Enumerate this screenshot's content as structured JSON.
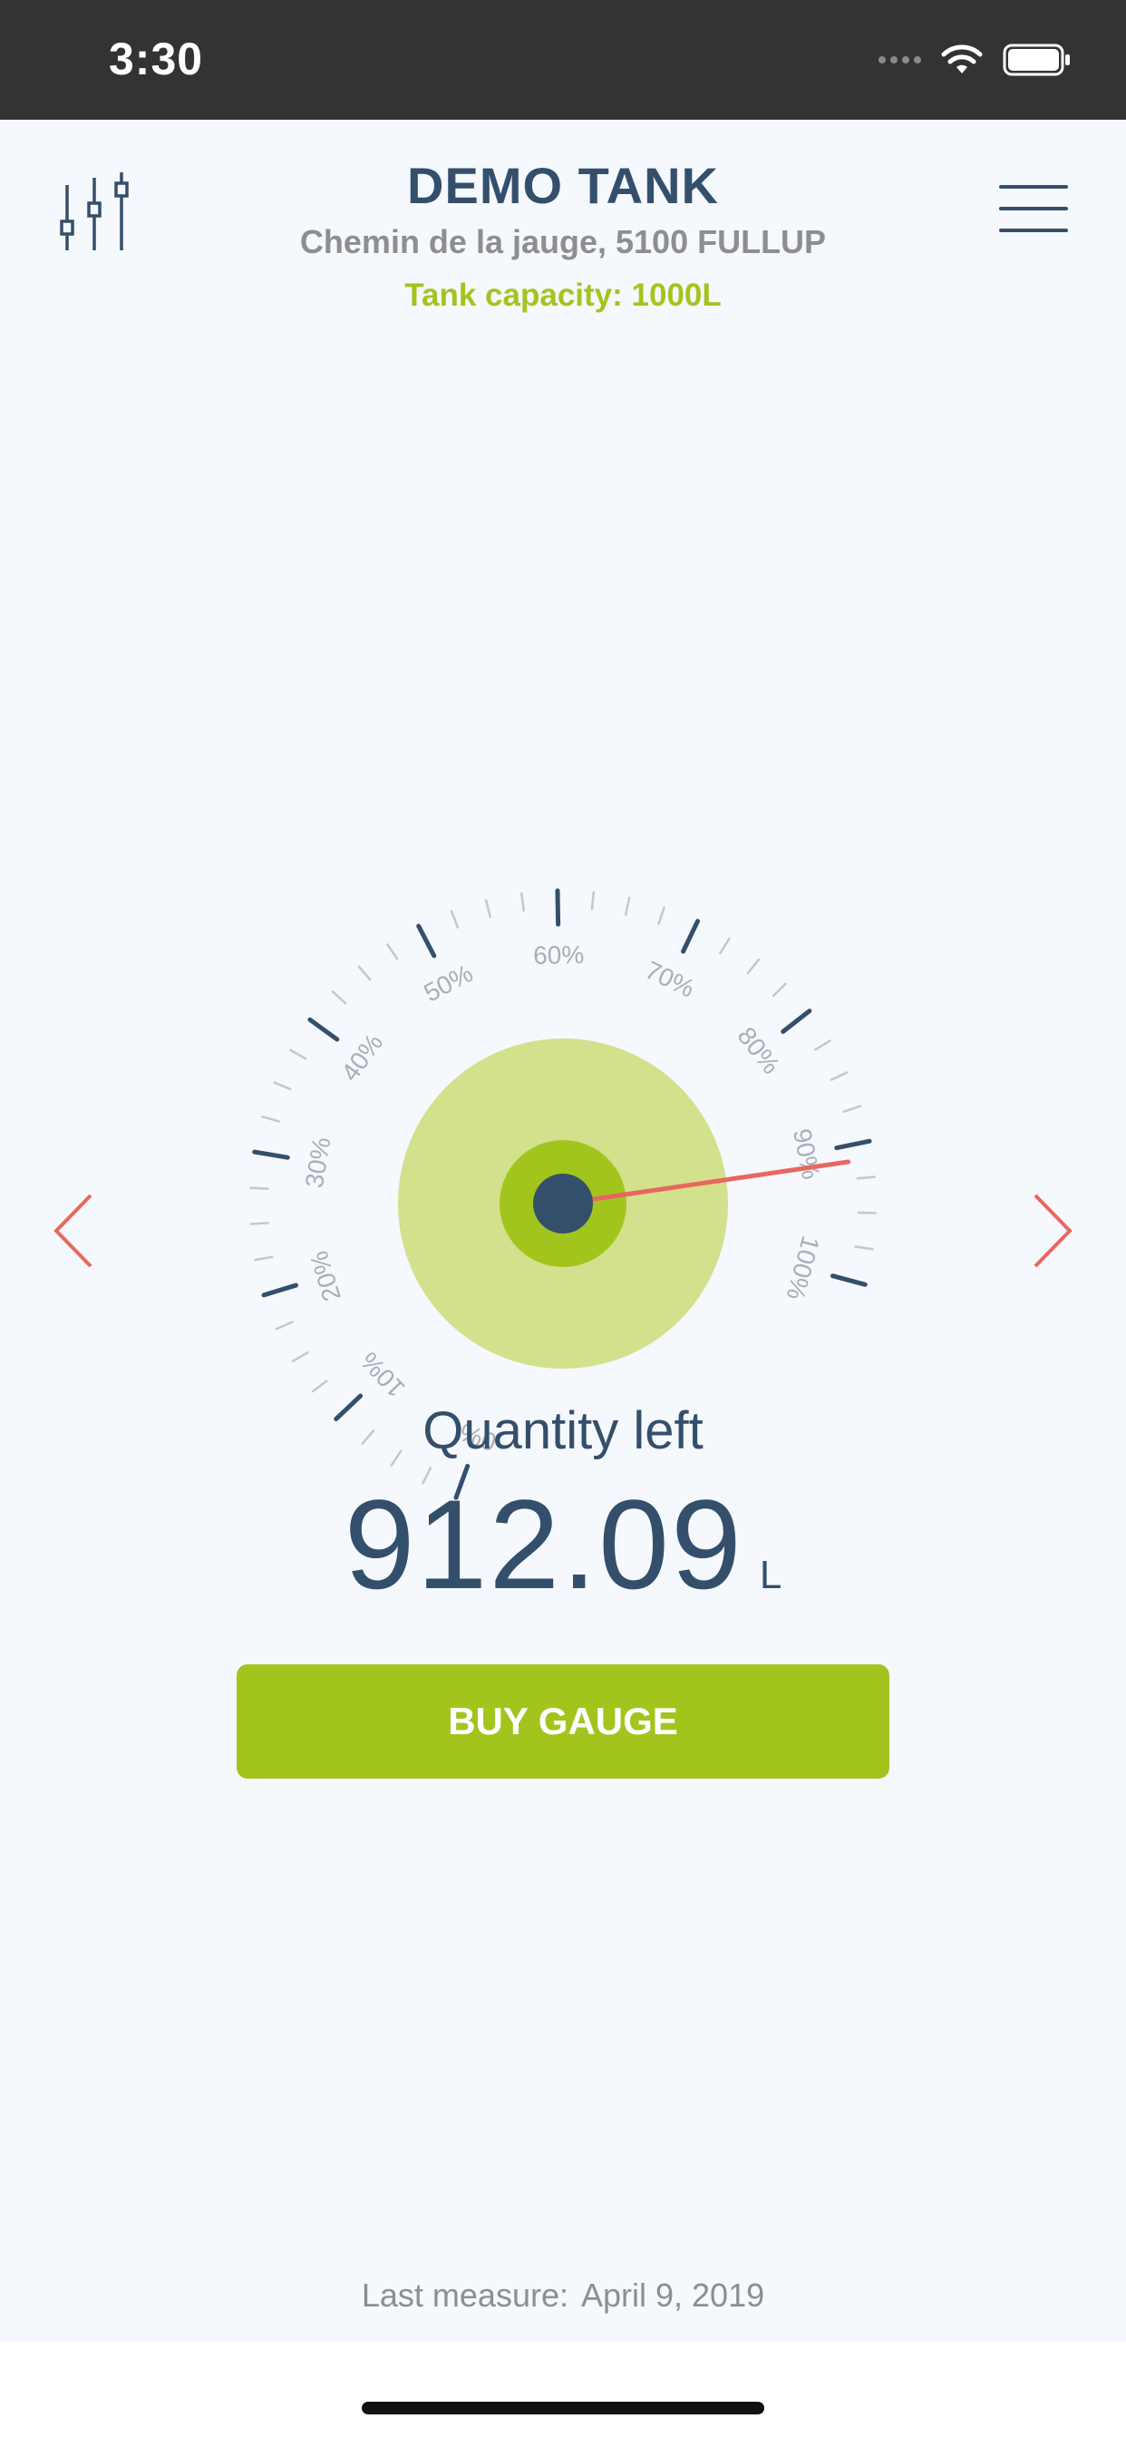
{
  "status_bar": {
    "time": "3:30"
  },
  "header": {
    "title": "DEMO TANK",
    "address": "Chemin de la jauge, 5100 FULLUP",
    "capacity": "Tank capacity: 1000L"
  },
  "icons": {
    "filter": "sliders-icon",
    "menu": "hamburger-menu-icon",
    "prev": "chevron-left-icon",
    "next": "chevron-right-icon"
  },
  "gauge": {
    "labels": [
      "0%",
      "10%",
      "20%",
      "30%",
      "40%",
      "50%",
      "60%",
      "70%",
      "80%",
      "90%",
      "100%"
    ],
    "fill_percent": 91.2
  },
  "quantity": {
    "label": "Quantity left",
    "value": "912.09",
    "unit": "L"
  },
  "buy_button": {
    "label": "BUY GAUGE"
  },
  "last_measure": {
    "label": "Last measure:",
    "date": "April 9, 2019"
  },
  "colors": {
    "accent": "#a2c51e",
    "navy": "#344f6b",
    "needle": "#e8675f",
    "arrows": "#e8675f",
    "gauge_outer": "#d3e08c",
    "status_bar": "#333333"
  }
}
